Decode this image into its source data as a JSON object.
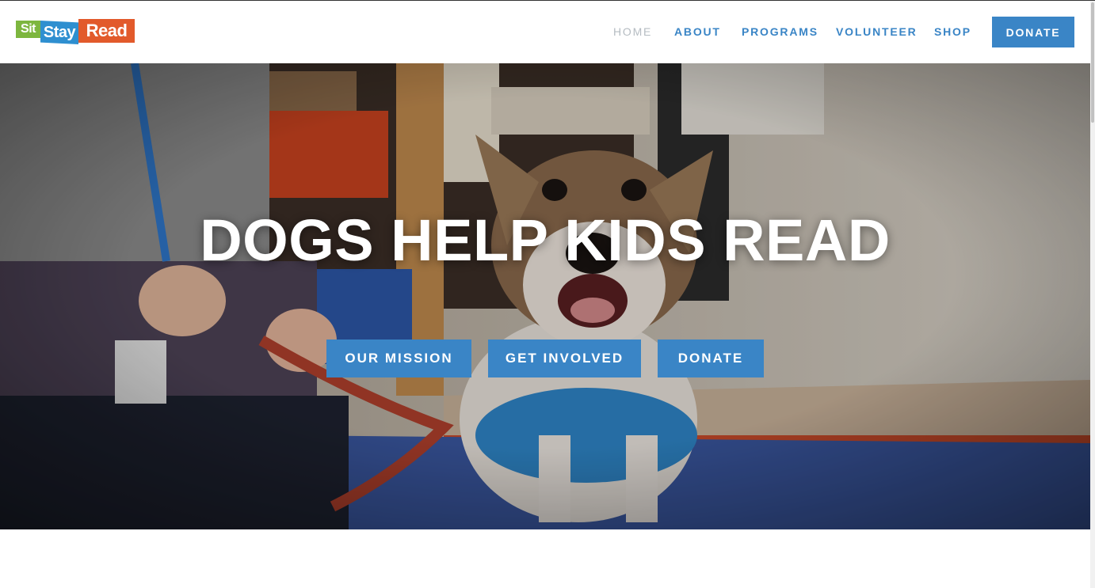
{
  "brand": {
    "logo_sit": "Sit",
    "logo_stay": "Stay",
    "logo_read": "Read",
    "colors": {
      "sit": "#7db63f",
      "stay": "#2e8fd0",
      "read": "#e25a2b"
    }
  },
  "nav": {
    "home": "HOME",
    "about": "ABOUT",
    "programs": "PROGRAMS",
    "volunteer": "VOLUNTEER",
    "shop": "SHOP",
    "donate": "DONATE",
    "accent_color": "#3a85c6"
  },
  "hero": {
    "title": "DOGS HELP KIDS READ",
    "buttons": {
      "mission": "OUR MISSION",
      "involved": "GET INVOLVED",
      "donate": "DONATE"
    }
  }
}
